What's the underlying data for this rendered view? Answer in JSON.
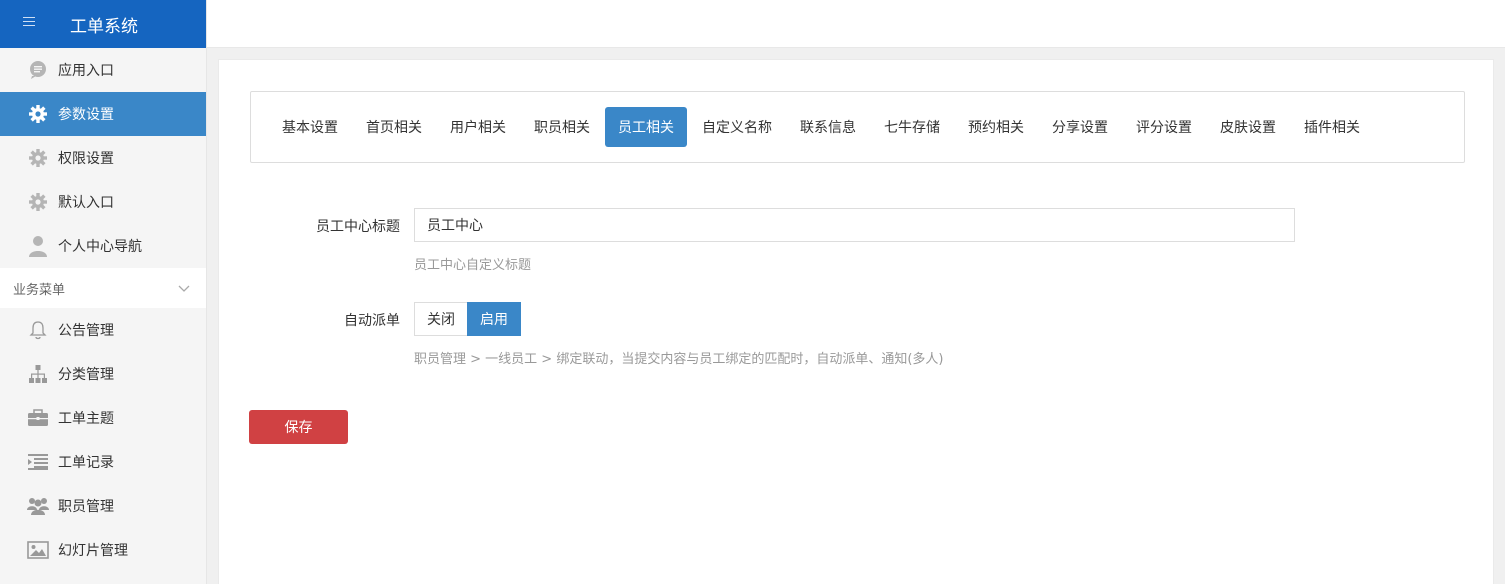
{
  "brand": {
    "title": "工单系统"
  },
  "sidebar": {
    "items": [
      {
        "label": "应用入口",
        "icon": "chat-bubble-icon"
      },
      {
        "label": "参数设置",
        "icon": "gear-icon",
        "active": true
      },
      {
        "label": "权限设置",
        "icon": "gear-icon"
      },
      {
        "label": "默认入口",
        "icon": "gear-icon"
      },
      {
        "label": "个人中心导航",
        "icon": "user-icon"
      }
    ],
    "section": {
      "label": "业务菜单"
    },
    "business_items": [
      {
        "label": "公告管理",
        "icon": "bell-icon"
      },
      {
        "label": "分类管理",
        "icon": "sitemap-icon"
      },
      {
        "label": "工单主题",
        "icon": "briefcase-icon"
      },
      {
        "label": "工单记录",
        "icon": "list-indent-icon"
      },
      {
        "label": "职员管理",
        "icon": "users-icon"
      },
      {
        "label": "幻灯片管理",
        "icon": "image-icon"
      }
    ]
  },
  "tabs": [
    {
      "label": "基本设置"
    },
    {
      "label": "首页相关"
    },
    {
      "label": "用户相关"
    },
    {
      "label": "职员相关"
    },
    {
      "label": "员工相关",
      "active": true
    },
    {
      "label": "自定义名称"
    },
    {
      "label": "联系信息"
    },
    {
      "label": "七牛存储"
    },
    {
      "label": "预约相关"
    },
    {
      "label": "分享设置"
    },
    {
      "label": "评分设置"
    },
    {
      "label": "皮肤设置"
    },
    {
      "label": "插件相关"
    }
  ],
  "form": {
    "title_label": "员工中心标题",
    "title_value": "员工中心",
    "title_help": "员工中心自定义标题",
    "auto_label": "自动派单",
    "auto_off": "关闭",
    "auto_on": "启用",
    "auto_selected": "启用",
    "auto_help": "职员管理 > 一线员工 > 绑定联动，当提交内容与员工绑定的匹配时，自动派单、通知(多人)",
    "save_label": "保存"
  },
  "colors": {
    "brand": "#1565c0",
    "accent": "#3a87c8",
    "save": "#d04143"
  }
}
